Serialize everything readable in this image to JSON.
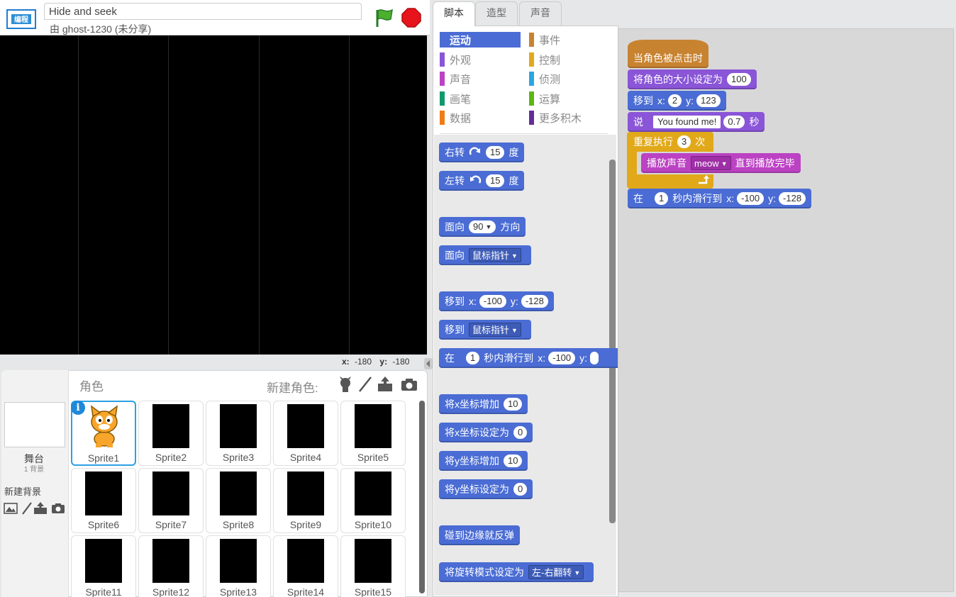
{
  "header": {
    "project_title": "Hide and seek",
    "byline": "由 ghost-1230 (未分享)"
  },
  "stage": {
    "coords_x_label": "x:",
    "coords_x": "-180",
    "coords_y_label": "y:",
    "coords_y": "-180"
  },
  "sprite_pane": {
    "stage_label": "舞台",
    "stage_count": "1 背景",
    "new_backdrop": "新建背景",
    "sprites_label": "角色",
    "new_sprite": "新建角色:",
    "selected_sprite": "Sprite1",
    "sprites": [
      "Sprite1",
      "Sprite2",
      "Sprite3",
      "Sprite4",
      "Sprite5",
      "Sprite6",
      "Sprite7",
      "Sprite8",
      "Sprite9",
      "Sprite10",
      "Sprite11",
      "Sprite12",
      "Sprite13",
      "Sprite14",
      "Sprite15"
    ]
  },
  "tabs": [
    "脚本",
    "造型",
    "声音"
  ],
  "categories": {
    "motion": "运动",
    "looks": "外观",
    "sound": "声音",
    "pen": "画笔",
    "data": "数据",
    "events": "事件",
    "control": "控制",
    "sensing": "侦测",
    "operators": "运算",
    "more": "更多积木"
  },
  "palette": {
    "turn_right": {
      "text": "右转",
      "value": "15",
      "unit": "度"
    },
    "turn_left": {
      "text": "左转",
      "value": "15",
      "unit": "度"
    },
    "point_direction": {
      "text": "面向",
      "value": "90",
      "unit": "方向"
    },
    "point_towards": {
      "text": "面向",
      "option": "鼠标指针"
    },
    "go_to_xy": {
      "text": "移到",
      "x_label": "x:",
      "x": "-100",
      "y_label": "y:",
      "y": "-128"
    },
    "go_to": {
      "text": "移到",
      "option": "鼠标指针"
    },
    "glide": {
      "prefix": "在",
      "secs": "1",
      "mid": "秒内滑行到",
      "x_label": "x:",
      "x": "-100",
      "y_label": "y:"
    },
    "change_x": {
      "text": "将x坐标增加",
      "value": "10"
    },
    "set_x": {
      "text": "将x坐标设定为",
      "value": "0"
    },
    "change_y": {
      "text": "将y坐标增加",
      "value": "10"
    },
    "set_y": {
      "text": "将y坐标设定为",
      "value": "0"
    },
    "bounce": {
      "text": "碰到边缘就反弹"
    },
    "rotation_style": {
      "text": "将旋转模式设定为",
      "option": "左-右翻转"
    }
  },
  "script": {
    "hat": "当角色被点击时",
    "set_size": {
      "text": "将角色的大小设定为",
      "value": "100"
    },
    "go_to": {
      "text": "移到",
      "x_label": "x:",
      "x": "2",
      "y_label": "y:",
      "y": "123"
    },
    "say": {
      "text": "说",
      "message": "You found me!",
      "secs": "0.7",
      "unit": "秒"
    },
    "repeat": {
      "text": "重复执行",
      "times": "3",
      "unit": "次"
    },
    "play_sound": {
      "text": "播放声音",
      "sound": "meow",
      "suffix": "直到播放完毕"
    },
    "glide": {
      "prefix": "在",
      "secs": "1",
      "mid": "秒内滑行到",
      "x_label": "x:",
      "x": "-100",
      "y_label": "y:",
      "y": "-128"
    }
  },
  "colors": {
    "motion": "#4a6cd4",
    "looks": "#8a55d7",
    "sound": "#bb42c3",
    "pen": "#0e9a6c",
    "data": "#ee7d16",
    "events": "#c88330",
    "control": "#e1a91a",
    "sensing": "#2ca5e2",
    "operators": "#5cb712",
    "more": "#632d99"
  },
  "icons": [
    "scratch-logo-icon",
    "green-flag-icon",
    "stop-icon",
    "paint-icon",
    "upload-icon",
    "camera-icon",
    "sprite-library-icon",
    "backdrop-library-icon",
    "rotate-right-icon",
    "rotate-left-icon",
    "info-icon"
  ]
}
